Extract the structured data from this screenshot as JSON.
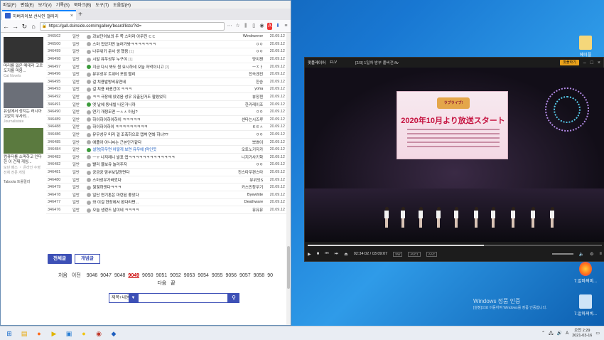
{
  "browser": {
    "menu": [
      "파일(F)",
      "편집(E)",
      "보기(V)",
      "기록(S)",
      "북마크(B)",
      "도구(T)",
      "도움말(H)"
    ],
    "tab_title": "하버리아보 선사인 갤러리",
    "url": "https://gall.dcinside.com/mgallery/board/lists/?id=",
    "new_tab": "+"
  },
  "sidebar": {
    "ads": [
      {
        "title": "머리를 잃은 메데리 고르도지를 마음...",
        "source": "Cat Novels",
        "color": "#333"
      },
      {
        "title": "유심에서 성지는 러시아 고없지 부사되...",
        "source": "Journalistate",
        "color": "#6b6f78"
      },
      {
        "title": "컴퓨터를 소파하고 인다한 이 건재 게임...",
        "source": "모던 패스 ・ 온라인 수영 전체 전문 게임",
        "color": "#5b7a3f"
      }
    ],
    "taboola": "Taboola 트롤릴러"
  },
  "posts": [
    {
      "num": "346502",
      "cat": "일반",
      "title": "과보단어보의 두 쪽 스마라 아무진 ㄷㄷ",
      "cmt": "",
      "writer": "Windrunner",
      "date": "20.09.12",
      "rec": false,
      "notice": false
    },
    {
      "num": "346500",
      "cat": "일반",
      "title": "스마 접었지만 놀러가봐ㅋㅋㅋㅋㅋㅋㅋ",
      "cmt": "",
      "writer": "ㅇㅇ",
      "date": "20.09.12",
      "rec": false,
      "notice": false
    },
    {
      "num": "346499",
      "cat": "일반",
      "title": "나무위키 문서 생 했음",
      "cmt": "[1]",
      "writer": "ㅇㅇ",
      "date": "20.09.12",
      "rec": false,
      "notice": false
    },
    {
      "num": "346498",
      "cat": "일반",
      "title": "시발 뮤우성우 누구야",
      "cmt": "[1]",
      "writer": "양치쟨",
      "date": "20.09.12",
      "rec": false,
      "notice": false
    },
    {
      "num": "346497",
      "cat": "일반",
      "title": "지금 다시 봐도 원 요시하네 오늘 저녁이니고",
      "cmt": "[3]",
      "writer": "ㅡㅈㅏ",
      "date": "20.09.12",
      "rec": true,
      "notice": false
    },
    {
      "num": "346496",
      "cat": "일반",
      "title": "뮤우성우 트위터 포럼 빨리",
      "cmt": "",
      "writer": "전속겐진",
      "date": "20.09.12",
      "rec": false,
      "notice": false
    },
    {
      "num": "346495",
      "cat": "일반",
      "title": "걸 치용발방비뮤연네",
      "cmt": "",
      "writer": "한승",
      "date": "20.09.12",
      "rec": false,
      "notice": false
    },
    {
      "num": "346493",
      "cat": "일반",
      "title": "걸 치용 바뀐건야 ㅋㅋㅋ",
      "cmt": "",
      "writer": "yoha",
      "date": "20.09.12",
      "rec": false,
      "notice": false
    },
    {
      "num": "346492",
      "cat": "일반",
      "title": "ㅋㅋ 극장에 있었음 성우 유출된거도 팔렸었지",
      "cmt": "",
      "writer": "뷰장젠",
      "date": "20.09.12",
      "rec": false,
      "notice": false
    },
    {
      "num": "346491",
      "cat": "일반",
      "title": "엣 날에 동네빌 나온거니까",
      "cmt": "",
      "writer": "한카레이조",
      "date": "20.09.12",
      "rec": true,
      "notice": false
    },
    {
      "num": "346490",
      "cat": "일반",
      "title": "연기 개쟁도면 ㅡㅅㅅ 아님?",
      "cmt": "",
      "writer": "ㅇㅇ",
      "date": "20.09.12",
      "rec": false,
      "notice": false
    },
    {
      "num": "346489",
      "cat": "일반",
      "title": "하이하이하이하이 ㅋㅋㅋㅋㅋ",
      "cmt": "",
      "writer": "센타는시즈루",
      "date": "20.09.12",
      "rec": false,
      "notice": false
    },
    {
      "num": "346488",
      "cat": "일반",
      "title": "하이하이하이 ㅋㅋㅋㅋㅋㅋㅋㅋㅋ",
      "cmt": "",
      "writer": "ㅌㅌㅅ",
      "date": "20.09.12",
      "rec": false,
      "notice": false
    },
    {
      "num": "346486",
      "cat": "일반",
      "title": "뮤우성우 미리 걸 조축하으로 캡쳐 연봐 하냐??",
      "cmt": "",
      "writer": "ㅇㅇ",
      "date": "20.09.12",
      "rec": false,
      "notice": false
    },
    {
      "num": "346485",
      "cat": "일반",
      "title": "애플아 아니씨는 근본인거같다",
      "cmt": "",
      "writer": "뽀쁘이",
      "date": "20.09.12",
      "rec": false,
      "notice": false
    },
    {
      "num": "346484",
      "cat": "일반",
      "title": "설명[하우면 어떻게 보면 뮤우에 [약인듯",
      "cmt": "",
      "writer": "오토노키자카",
      "date": "20.09.12",
      "rec": true,
      "notice": true
    },
    {
      "num": "346483",
      "cat": "일반",
      "title": "ㅡㅜ 나저레니 발표 앱ㅋㅋㅋㅋㅋㅋㅋㅋㅋㅋㅋㅋㅋ",
      "cmt": "",
      "writer": "니지가사키학",
      "date": "20.09.12",
      "rec": false,
      "notice": false
    },
    {
      "num": "346482",
      "cat": "일반",
      "title": "빨리 뮬보유 놀러주자",
      "cmt": "",
      "writer": "ㅇㅇ",
      "date": "20.09.12",
      "rec": false,
      "notice": false
    },
    {
      "num": "346481",
      "cat": "일반",
      "title": "궁금궁 맘부보일양면다",
      "cmt": "",
      "writer": "진스타우편스타",
      "date": "20.09.12",
      "rec": false,
      "notice": false
    },
    {
      "num": "346480",
      "cat": "일반",
      "title": "스마성우가바껐다",
      "cmt": "",
      "writer": "뮤위잇S",
      "date": "20.09.12",
      "rec": false,
      "notice": false
    },
    {
      "num": "346479",
      "cat": "일반",
      "title": "뭥뭥하댄다ㅋㅋㅋ",
      "cmt": "",
      "writer": "카스민창무기",
      "date": "20.09.12",
      "rec": false,
      "notice": false
    },
    {
      "num": "346478",
      "cat": "일반",
      "title": "일단 연기톤은 마련된 좋았다",
      "cmt": "",
      "writer": "Byewhite",
      "date": "20.09.12",
      "rec": false,
      "notice": false
    },
    {
      "num": "346477",
      "cat": "일반",
      "title": "와 이걸 현장에서 봤다라면...",
      "cmt": "",
      "writer": "Deathware",
      "date": "20.09.12",
      "rec": false,
      "notice": false
    },
    {
      "num": "346476",
      "cat": "일반",
      "title": "오늘 생겠드 날이네 ㅋㅋㅋㅋ",
      "cmt": "",
      "writer": "뮤뮤뮤",
      "date": "20.09.12",
      "rec": false,
      "notice": false
    }
  ],
  "buttons": {
    "all": "전체글",
    "recommend": "개념글"
  },
  "pager": {
    "first": "처음",
    "prev": "이전",
    "pages": [
      "9046",
      "9047",
      "9048",
      "9049",
      "9050",
      "9051",
      "9052",
      "9053",
      "9054",
      "9055",
      "9056",
      "9057",
      "9058",
      "90"
    ],
    "current": "9049",
    "next": "다음",
    "last": "끝"
  },
  "search": {
    "select": "제목+내용",
    "placeholder": ""
  },
  "player": {
    "brand": "팟플레이어",
    "format": "FLV",
    "file": "[2/3] 1일차 밤부 풀버전.flv",
    "upgrade": "팟플하기",
    "screen_headline": "2020年10月より放送スタート",
    "screen_logo": "ラブライブ!",
    "time": "02:34:02 / 03:09:07",
    "tags": [
      "SW",
      "AVC1",
      "AAC"
    ],
    "seek_progress": 0.6
  },
  "desktop": {
    "icons": [
      {
        "label": "메이플",
        "color": "#f5d77a"
      },
      {
        "label": "7.알마져비...",
        "color": "#ff6a1a"
      },
      {
        "label": "7.알마져비...",
        "color": "#cfe4f7"
      }
    ]
  },
  "watermark": {
    "line1": "Windows 정품 인증",
    "line2": "[설정]으로 이동하여 Windows를 정품 인증합니다."
  },
  "taskbar": {
    "clock_time": "오전 2:29",
    "clock_date": "2021-03-16",
    "lang": "A"
  }
}
